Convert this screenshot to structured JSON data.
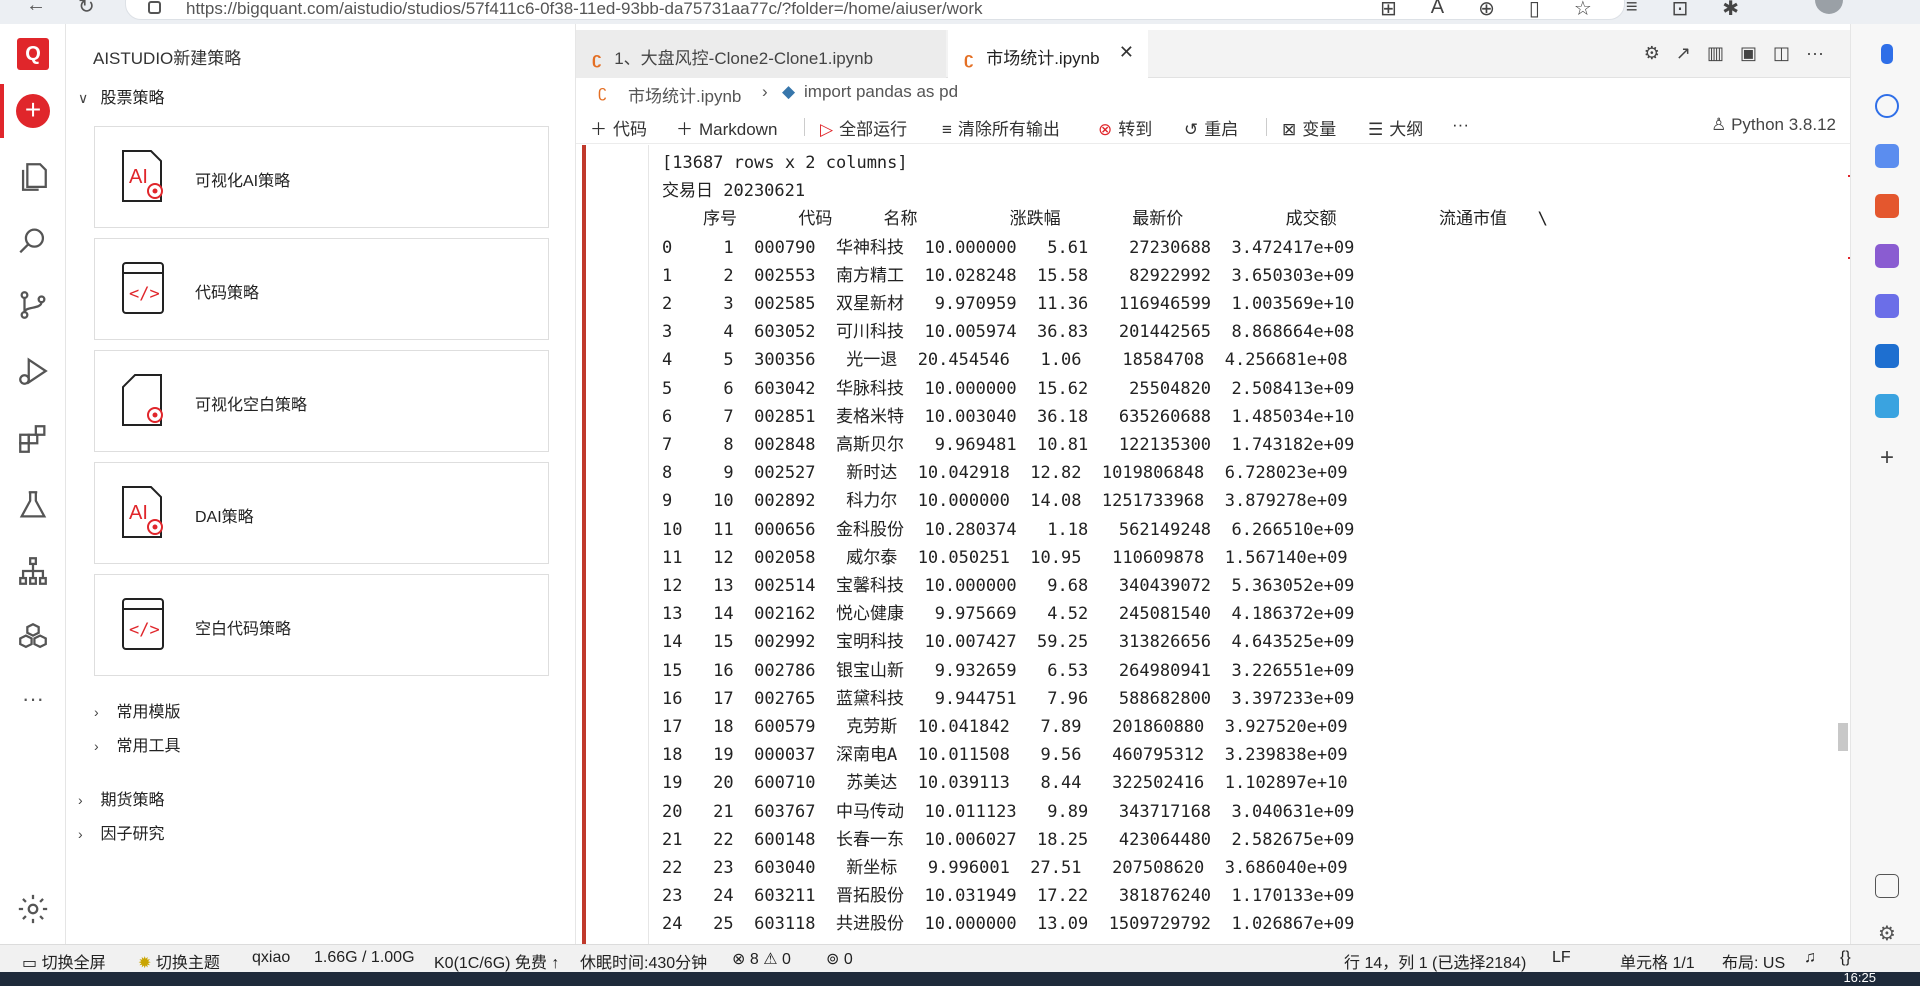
{
  "browser": {
    "url": "https://bigquant.com/aistudio/studios/57f411c6-0f38-11ed-93bb-da75731aa77c/?folder=/home/aiuser/work"
  },
  "sidebar": {
    "title": "AISTUDIO新建策略",
    "section_stock": "股票策略",
    "cards": [
      {
        "label": "可视化AI策略"
      },
      {
        "label": "代码策略"
      },
      {
        "label": "可视化空白策略"
      },
      {
        "label": "DAI策略"
      },
      {
        "label": "空白代码策略"
      }
    ],
    "sub_templates": "常用模版",
    "sub_tools": "常用工具",
    "section_futures": "期货策略",
    "section_factor": "因子研究"
  },
  "tabs": [
    {
      "label": "1、大盘风控-Clone2-Clone1.ipynb"
    },
    {
      "label": "市场统计.ipynb"
    }
  ],
  "breadcrumb": {
    "file": "市场统计.ipynb",
    "symbol": "import pandas as pd"
  },
  "toolbar": {
    "code": "代码",
    "markdown": "Markdown",
    "run_all": "全部运行",
    "clear_output": "清除所有输出",
    "goto": "转到",
    "restart": "重启",
    "variables": "变量",
    "outline": "大纲",
    "kernel": "Python 3.8.12"
  },
  "output": {
    "line_rows": "[13687 rows x 2 columns]",
    "line_date": "交易日 20230621",
    "header": "    序号      代码     名称         涨跌幅       最新价          成交额          流通市值   \\",
    "rows": [
      "0     1  000790  华神科技  10.000000   5.61    27230688  3.472417e+09",
      "1     2  002553  南方精工  10.028248  15.58    82922992  3.650303e+09",
      "2     3  002585  双星新材   9.970959  11.36   116946599  1.003569e+10",
      "3     4  603052  可川科技  10.005974  36.83   201442565  8.868664e+08",
      "4     5  300356   光一退  20.454546   1.06    18584708  4.256681e+08",
      "5     6  603042  华脉科技  10.000000  15.62    25504820  2.508413e+09",
      "6     7  002851  麦格米特  10.003040  36.18   635260688  1.485034e+10",
      "7     8  002848  高斯贝尔   9.969481  10.81   122135300  1.743182e+09",
      "8     9  002527   新时达  10.042918  12.82  1019806848  6.728023e+09",
      "9    10  002892   科力尔  10.000000  14.08  1251733968  3.879278e+09",
      "10   11  000656  金科股份  10.280374   1.18   562149248  6.266510e+09",
      "11   12  002058   威尔泰  10.050251  10.95   110609878  1.567140e+09",
      "12   13  002514  宝馨科技  10.000000   9.68   340439072  5.363052e+09",
      "13   14  002162  悦心健康   9.975669   4.52   245081540  4.186372e+09",
      "14   15  002992  宝明科技  10.007427  59.25   313826656  4.643525e+09",
      "15   16  002786  银宝山新   9.932659   6.53   264980941  3.226551e+09",
      "16   17  002765  蓝黛科技   9.944751   7.96   588682800  3.397233e+09",
      "17   18  600579   克劳斯  10.041842   7.89   201860880  3.927520e+09",
      "18   19  000037  深南电A  10.011508   9.56   460795312  3.239838e+09",
      "19   20  600710   苏美达  10.039113   8.44   322502416  1.102897e+10",
      "20   21  603767  中马传动  10.011123   9.89   343717168  3.040631e+09",
      "21   22  600148  长春一东  10.006027  18.25   423064480  2.582675e+09",
      "22   23  603040   新坐标   9.996001  27.51   207508620  3.686040e+09",
      "23   24  603211  晋拓股份  10.031949  17.22   381876240  1.170133e+09",
      "24   25  603118  共进股份  10.000000  13.09  1509729792  1.026867e+09"
    ]
  },
  "status": {
    "fullscreen": "切换全屏",
    "theme": "切换主题",
    "user": "qxiao",
    "memory": "1.66G / 1.00G",
    "kernel_quota": "K0(1C/6G) 免费 ↑",
    "sleep": "休眠时间:430分钟",
    "problems": "8",
    "warnings": "0",
    "ports": "0",
    "cursor": "行 14，列 1 (已选择2184)",
    "eol": "LF",
    "cell": "单元格 1/1",
    "layout": "布局: US",
    "clock": "16:25"
  },
  "colors": {
    "brand": "#e0262b",
    "notebook_accent": "#e46f24"
  }
}
